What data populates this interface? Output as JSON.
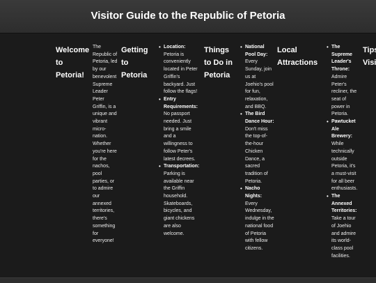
{
  "header": {
    "title": "Visitor Guide to the Republic of Petoria"
  },
  "sections": {
    "welcome": {
      "title": "Welcome to Petoria!",
      "text": "The Republic of Petoria, led by our benevolent Supreme Leader Peter Griffin, is a unique and vibrant micro-nation. Whether you're here for the nachos, pool parties, or to admire our annexed territories, there's something for everyone!"
    },
    "getting": {
      "title": "Getting to Petoria",
      "items": [
        {
          "label": "Location:",
          "text": "Petoria is conveniently located in Peter Griffin's backyard. Just follow the flags!"
        },
        {
          "label": "Entry Requirements:",
          "text": "No passport needed. Just bring a smile and a willingness to follow Peter's latest decrees."
        },
        {
          "label": "Transportation:",
          "text": "Parking is available near the Griffin household. Skateboards, bicycles, and giant chickens are also welcome."
        }
      ]
    },
    "things": {
      "title": "Things to Do in Petoria",
      "items": [
        {
          "label": "National Pool Day:",
          "text": "Every Sunday, join us at Joehio's pool for fun, relaxation, and BBQ."
        },
        {
          "label": "The Bird Dance Hour:",
          "text": "Don't miss the top-of-the-hour Chicken Dance, a sacred tradition of Petoria."
        },
        {
          "label": "Nacho Nights:",
          "text": "Every Wednesday, indulge in the national food of Petoria with fellow citizens."
        }
      ]
    },
    "local": {
      "title": "Local Attractions",
      "items": [
        {
          "label": "The Supreme Leader's Throne:",
          "text": "Admire Peter's recliner, the seat of power in Petoria."
        },
        {
          "label": "Pawtucket Ale Brewery:",
          "text": "While technically outside Petoria, it's a must-visit for all beer enthusiasts."
        },
        {
          "label": "The Annexed Territories:",
          "text": "Take a tour of Joehio and admire its world-class pool facilities."
        }
      ]
    },
    "tips": {
      "title": "Tips for Visitors"
    }
  }
}
